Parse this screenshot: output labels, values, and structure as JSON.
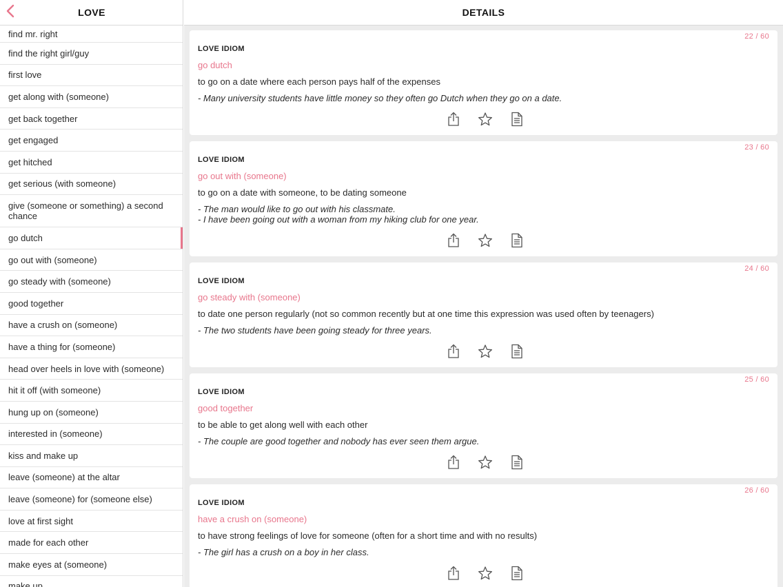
{
  "left_pane": {
    "title": "LOVE",
    "back_icon": "chevron-left-icon",
    "accent": "#e8768c",
    "items": [
      {
        "label": "find mr. right"
      },
      {
        "label": "find the right girl/guy"
      },
      {
        "label": "first love"
      },
      {
        "label": "get along with (someone)"
      },
      {
        "label": "get back together"
      },
      {
        "label": "get engaged"
      },
      {
        "label": "get hitched"
      },
      {
        "label": "get serious (with someone)"
      },
      {
        "label": "give (someone or something) a second chance"
      },
      {
        "label": "go dutch"
      },
      {
        "label": "go out with (someone)"
      },
      {
        "label": "go steady with (someone)"
      },
      {
        "label": "good together"
      },
      {
        "label": "have a crush on (someone)"
      },
      {
        "label": "have a thing for (someone)"
      },
      {
        "label": "head over heels in love with (someone)"
      },
      {
        "label": "hit it off (with someone)"
      },
      {
        "label": "hung up on (someone)"
      },
      {
        "label": "interested in (someone)"
      },
      {
        "label": "kiss and make up"
      },
      {
        "label": "leave (someone) at the altar"
      },
      {
        "label": "leave (someone) for (someone else)"
      },
      {
        "label": "love at first sight"
      },
      {
        "label": "made for each other"
      },
      {
        "label": "make eyes at (someone)"
      },
      {
        "label": "make up"
      }
    ],
    "selected_item": "go dutch"
  },
  "right_pane": {
    "title": "DETAILS",
    "cards": [
      {
        "counter": "22 / 60",
        "category": "LOVE IDIOM",
        "term": "go dutch",
        "definition": "to go on a date where each person pays half of the expenses",
        "examples": [
          "- Many university students have little money so they often go Dutch when they go on a date."
        ]
      },
      {
        "counter": "23 / 60",
        "category": "LOVE IDIOM",
        "term": "go out with (someone)",
        "definition": "to go on a date with someone, to be dating someone",
        "examples": [
          "- The man would like to go out with his classmate.",
          "-  I have been going out with a woman from my hiking club for one year."
        ]
      },
      {
        "counter": "24 / 60",
        "category": "LOVE IDIOM",
        "term": "go steady with (someone)",
        "definition": "to date one person regularly (not so common recently but at one time this expression was used often by teenagers)",
        "examples": [
          "- The two students have been going steady for three years."
        ]
      },
      {
        "counter": "25 / 60",
        "category": "LOVE IDIOM",
        "term": "good together",
        "definition": "to be able to get along well with each other",
        "examples": [
          "- The couple are good together and nobody has ever seen them argue."
        ]
      },
      {
        "counter": "26 / 60",
        "category": "LOVE IDIOM",
        "term": "have a crush on (someone)",
        "definition": "to have strong feelings of love for someone (often for a short time and with no results)",
        "examples": [
          "- The girl has a crush on a boy in her class."
        ]
      }
    ],
    "action_icons": [
      "share-icon",
      "star-icon",
      "document-icon"
    ]
  }
}
